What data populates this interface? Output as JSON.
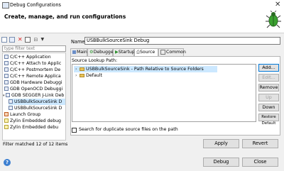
{
  "window": {
    "title": "Debug Configurations"
  },
  "header": {
    "title": "Create, manage, and run configurations"
  },
  "left": {
    "filter_placeholder": "type filter text",
    "tree": [
      {
        "label": "C/C++ Application"
      },
      {
        "label": "C/C++ Attach to Applic"
      },
      {
        "label": "C/C++ Postmortem De"
      },
      {
        "label": "C/C++ Remote Applica"
      },
      {
        "label": "GDB Hardware Debuggi"
      },
      {
        "label": "GDB OpenOCD Debuggi"
      },
      {
        "label": "GDB SEGGER J-Link Deb"
      },
      {
        "label": "USBBulkSourceSink D"
      },
      {
        "label": "USBBulkSourceSink D"
      },
      {
        "label": "Launch Group"
      },
      {
        "label": "Zylin Embedded debug"
      },
      {
        "label": "Zylin Embedded debu"
      }
    ],
    "status": "Filter matched 12 of 12 items"
  },
  "right": {
    "name_label": "Name:",
    "name_value": "USBBulkSourceSink Debug",
    "tabs": [
      "Main",
      "Debugger",
      "Startup",
      "Source",
      "Common"
    ],
    "source_lookup_label": "Source Lookup Path:",
    "source_items": [
      {
        "label": "USBBulkSourceSink - Path Relative to Source Folders"
      },
      {
        "label": "Default"
      }
    ],
    "buttons": {
      "add": "Add...",
      "edit": "Edit...",
      "remove": "Remove",
      "up": "Up",
      "down": "Down",
      "restore": "Restore Default"
    },
    "duplicate_checkbox_label": "Search for duplicate source files on the path",
    "apply": "Apply",
    "revert": "Revert"
  },
  "footer": {
    "debug": "Debug",
    "close": "Close"
  }
}
